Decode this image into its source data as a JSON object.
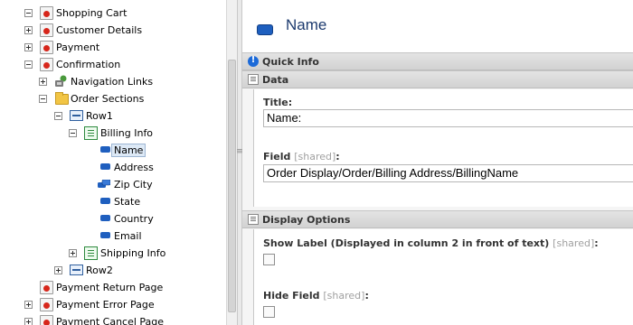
{
  "tree": {
    "items": [
      {
        "id": "shopping-cart",
        "label": "Shopping Cart",
        "icon": "page-icon",
        "toggle": "minus"
      },
      {
        "id": "customer-details",
        "label": "Customer Details",
        "icon": "page-icon",
        "toggle": "plus"
      },
      {
        "id": "payment",
        "label": "Payment",
        "icon": "page-icon",
        "toggle": "plus"
      },
      {
        "id": "confirmation",
        "label": "Confirmation",
        "icon": "page-icon",
        "toggle": "minus"
      },
      {
        "id": "navigation-links",
        "label": "Navigation Links",
        "icon": "links-icon",
        "toggle": "plus"
      },
      {
        "id": "order-sections",
        "label": "Order Sections",
        "icon": "folder-icon",
        "toggle": "minus"
      },
      {
        "id": "row1",
        "label": "Row1",
        "icon": "row-icon",
        "toggle": "minus"
      },
      {
        "id": "billing-info",
        "label": "Billing Info",
        "icon": "info-section-icon",
        "toggle": "minus"
      },
      {
        "id": "name",
        "label": "Name",
        "icon": "field-icon",
        "selected": true
      },
      {
        "id": "address",
        "label": "Address",
        "icon": "field-icon"
      },
      {
        "id": "zip-city",
        "label": "Zip City",
        "icon": "multi-field-icon"
      },
      {
        "id": "state",
        "label": "State",
        "icon": "field-icon"
      },
      {
        "id": "country",
        "label": "Country",
        "icon": "field-icon"
      },
      {
        "id": "email",
        "label": "Email",
        "icon": "field-icon"
      },
      {
        "id": "shipping-info",
        "label": "Shipping Info",
        "icon": "info-section-icon",
        "toggle": "plus"
      },
      {
        "id": "row2",
        "label": "Row2",
        "icon": "row-icon",
        "toggle": "plus"
      },
      {
        "id": "payment-return-page",
        "label": "Payment Return Page",
        "icon": "page-icon"
      },
      {
        "id": "payment-error-page",
        "label": "Payment Error Page",
        "icon": "page-icon",
        "toggle": "plus"
      },
      {
        "id": "payment-cancel-page",
        "label": "Payment Cancel Page",
        "icon": "page-icon",
        "toggle": "plus"
      }
    ]
  },
  "splitter": {
    "grip": "≡"
  },
  "detail": {
    "title": "Name",
    "quick_info_label": "Quick Info",
    "data_label": "Data",
    "title_field": {
      "label": "Title:",
      "value": "Name:"
    },
    "field_field": {
      "label": "Field",
      "shared": "[shared]",
      "colon": ":",
      "value": "Order Display/Order/Billing Address/BillingName"
    },
    "display_options_label": "Display Options",
    "show_label": {
      "label": "Show Label (Displayed in column 2 in front of text)",
      "shared": "[shared]",
      "colon": ":",
      "checked": false
    },
    "hide_field": {
      "label": "Hide Field",
      "shared": "[shared]",
      "colon": ":",
      "checked": false
    }
  },
  "colors": {
    "selection": "#dde9f6",
    "title": "#1c3a6e",
    "bar": "#d2d2d2"
  }
}
